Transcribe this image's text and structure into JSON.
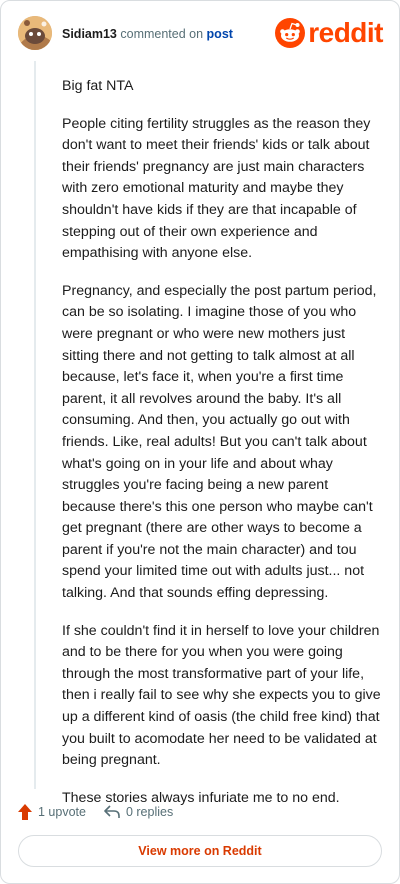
{
  "header": {
    "username": "Sidiam13",
    "action_text": "commented on",
    "post_link": "post",
    "logo_text": "reddit"
  },
  "comment": {
    "paragraphs": [
      "Big fat NTA",
      "People citing fertility struggles as the reason they don't want to meet their friends' kids or talk about their friends' pregnancy are just main characters with zero emotional maturity and maybe they shouldn't have kids if they are that incapable of stepping out of their own experience and empathising with anyone else.",
      "Pregnancy, and especially the post partum period, can be so isolating. I imagine those of you who were pregnant or who were new mothers just sitting there and not getting to talk almost at all because, let's face it, when you're a first time parent, it all revolves around the baby. It's all consuming. And then, you actually go out with friends. Like, real adults! But you can't talk about what's going on in your life and about whay struggles you're facing being a new parent because there's this one person who maybe can't get pregnant (there are other ways to become a parent if you're not the main character) and tou spend your limited time out with adults just... not talking. And that sounds effing depressing.",
      "If she couldn't find it in herself to love your children and to be there for you when you were going through the most transformative part of your life, then i really fail to see why she expects you to give up a different kind of oasis (the child free kind) that you built to acomodate her need to be validated at being pregnant.",
      "These stories always infuriate me to no end."
    ]
  },
  "footer": {
    "upvote_label": "1 upvote",
    "replies_label": "0 replies",
    "view_more_label": "View more on Reddit"
  },
  "colors": {
    "brand": "#ff4500",
    "link": "#0045ac",
    "view_more": "#d93a00",
    "muted": "#576f76"
  },
  "icons": {
    "avatar": "snoo-avatar",
    "logo": "reddit-snoo-logo",
    "upvote": "upvote-arrow-icon",
    "reply": "reply-arrow-icon"
  }
}
